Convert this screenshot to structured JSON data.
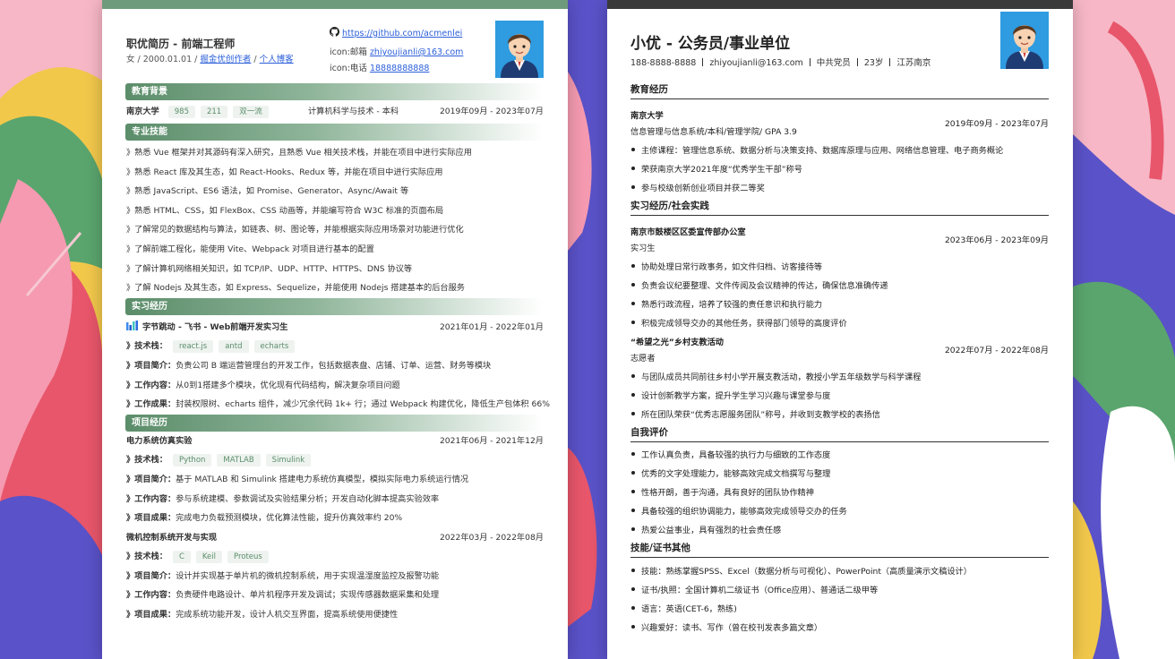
{
  "left": {
    "title": "职优简历 - 前端工程师",
    "subtitle_text": "女 / 2000.01.01 / ",
    "link_juejin": "掘金优创作者",
    "sep": " / ",
    "link_blog": "个人博客",
    "github": "https://github.com/acmenlei",
    "email_label": "icon:邮箱",
    "email": "zhiyoujianli@163.com",
    "phone_label": "icon:电话",
    "phone": "18888888888",
    "sections": {
      "education": "教育背景",
      "skills": "专业技能",
      "intern": "实习经历",
      "projects": "项目经历"
    },
    "edu": {
      "school": "南京大学",
      "tags": [
        "985",
        "211",
        "双一流"
      ],
      "major": "计算机科学与技术 - 本科",
      "date": "2019年09月 - 2023年07月"
    },
    "skills": [
      "》熟悉 Vue 框架并对其源码有深入研究，且熟悉 Vue 相关技术栈，并能在项目中进行实际应用",
      "》熟悉 React 库及其生态，如 React-Hooks、Redux 等，并能在项目中进行实际应用",
      "》熟悉 JavaScript、ES6 语法，如 Promise、Generator、Async/Await 等",
      "》熟悉 HTML、CSS，如 FlexBox、CSS 动画等，并能编写符合 W3C 标准的页面布局",
      "》了解常见的数据结构与算法，如链表、树、图论等，并能根据实际应用场景对功能进行优化",
      "》了解前端工程化，能使用 Vite、Webpack 对项目进行基本的配置",
      "》了解计算机网络相关知识，如 TCP/IP、UDP、HTTP、HTTPS、DNS 协议等",
      "》了解 Nodejs 及其生态，如 Express、Sequelize，并能使用 Nodejs 搭建基本的后台服务"
    ],
    "intern": {
      "company": "字节跳动 - 飞书 - Web前端开发实习生",
      "date": "2021年01月 - 2022年01月",
      "stack_label": "》技术栈：",
      "tags": [
        "react.js",
        "antd",
        "echarts"
      ],
      "intro_label": "》项目简介：",
      "intro": "负责公司 B 端运营管理台的开发工作，包括数据表盘、店铺、订单、运营、财务等模块",
      "work_label": "》工作内容：",
      "work": "从0到1搭建多个模块，优化现有代码结构，解决复杂项目问题",
      "result_label": "》工作成果：",
      "result": "封装权限树、echarts 组件，减少冗余代码 1k+ 行；通过 Webpack 构建优化，降低生产包体积 66%"
    },
    "projects": [
      {
        "name": "电力系统仿真实验",
        "date": "2021年06月 - 2021年12月",
        "stack_label": "》技术栈：",
        "tags": [
          "Python",
          "MATLAB",
          "Simulink"
        ],
        "intro_label": "》项目简介：",
        "intro": "基于 MATLAB 和 Simulink 搭建电力系统仿真模型，模拟实际电力系统运行情况",
        "work_label": "》工作内容：",
        "work": "参与系统建模、参数调试及实验结果分析；开发自动化脚本提高实验效率",
        "result_label": "》项目成果：",
        "result": "完成电力负载预测模块，优化算法性能，提升仿真效率约 20%"
      },
      {
        "name": "微机控制系统开发与实现",
        "date": "2022年03月 - 2022年08月",
        "stack_label": "》技术栈：",
        "tags": [
          "C",
          "Keil",
          "Proteus"
        ],
        "intro_label": "》项目简介：",
        "intro": "设计并实现基于单片机的微机控制系统，用于实现温湿度监控及报警功能",
        "work_label": "》工作内容：",
        "work": "负责硬件电路设计、单片机程序开发及调试；实现传感器数据采集和处理",
        "result_label": "》项目成果：",
        "result": "完成系统功能开发，设计人机交互界面，提高系统使用便捷性"
      }
    ]
  },
  "right": {
    "title": "小优 - 公务员/事业单位",
    "info": [
      "188-8888-8888",
      "zhiyoujianli@163.com",
      "中共党员",
      "23岁",
      "江苏南京"
    ],
    "sec_edu": "教育经历",
    "school": "南京大学",
    "school_detail": "信息管理与信息系统/本科/管理学院/ GPA 3.9",
    "school_date": "2019年09月 - 2023年07月",
    "edu_bullets": [
      "主修课程：管理信息系统、数据分析与决策支持、数据库原理与应用、网络信息管理、电子商务概论",
      "荣获南京大学2021年度“优秀学生干部”称号",
      "参与校级创新创业项目并获二等奖"
    ],
    "sec_intern": "实习经历/社会实践",
    "intern1_org": "南京市鼓楼区区委宣传部办公室",
    "intern1_role": "实习生",
    "intern1_date": "2023年06月 - 2023年09月",
    "intern1_bullets": [
      "协助处理日常行政事务，如文件归档、访客接待等",
      "负责会议纪要整理、文件传阅及会议精神的传达，确保信息准确传递",
      "熟悉行政流程，培养了较强的责任意识和执行能力",
      "积极完成领导交办的其他任务，获得部门领导的高度评价"
    ],
    "intern2_org": "“希望之光”乡村支教活动",
    "intern2_role": "志愿者",
    "intern2_date": "2022年07月 - 2022年08月",
    "intern2_bullets": [
      "与团队成员共同前往乡村小学开展支教活动，教授小学五年级数学与科学课程",
      "设计创新教学方案，提升学生学习兴趣与课堂参与度",
      "所在团队荣获“优秀志愿服务团队”称号，并收到支教学校的表扬信"
    ],
    "sec_self": "自我评价",
    "self_bullets": [
      "工作认真负责，具备较强的执行力与细致的工作态度",
      "优秀的文字处理能力，能够高效完成文档撰写与整理",
      "性格开朗，善于沟通，具有良好的团队协作精神",
      "具备较强的组织协调能力，能够高效完成领导交办的任务",
      "热爱公益事业，具有强烈的社会责任感"
    ],
    "sec_skills": "技能/证书其他",
    "skill_bullets": [
      "技能：熟练掌握SPSS、Excel（数据分析与可视化）、PowerPoint（高质量演示文稿设计）",
      "证书/执照：全国计算机二级证书（Office应用）、普通话二级甲等",
      "语言：英语(CET-6，熟练)",
      "兴趣爱好：读书、写作（曾在校刊发表多篇文章）"
    ]
  },
  "colors": {
    "accent_green": "#5b8d6a",
    "bg_yellow": "#f2c84b",
    "bg_purple": "#5a52c8",
    "bg_pink": "#f59ab0",
    "avatar_blue": "#2f9be0"
  }
}
